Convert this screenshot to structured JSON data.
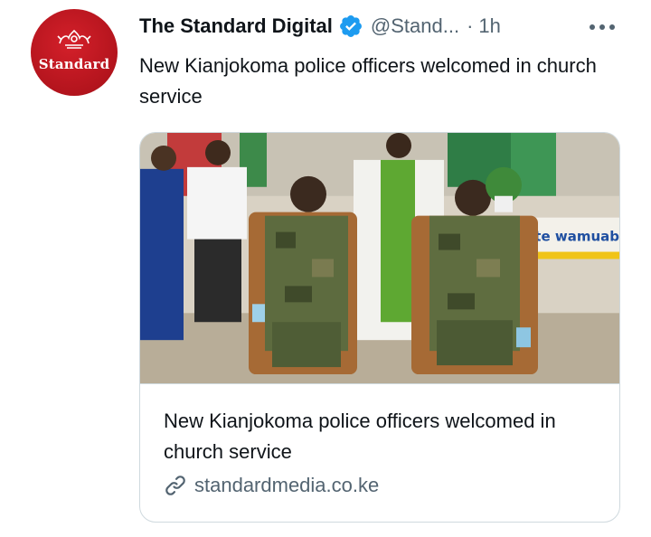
{
  "account": {
    "display_name": "The Standard Digital",
    "handle": "@Stand...",
    "separator": "·",
    "time": "1h",
    "avatar_text": "Standard",
    "avatar_color": "#c4161c",
    "verified_color": "#1d9bf0"
  },
  "tweet": {
    "text": "New Kianjokoma police officers welcomed in church service"
  },
  "card": {
    "title": "New Kianjokoma police officers welcomed in church service",
    "domain": "standardmedia.co.ke",
    "image_banner_text": "ote wamuabudu"
  },
  "icons": {
    "verified": "verified-badge-icon",
    "more": "more-options-icon",
    "link": "link-icon"
  }
}
